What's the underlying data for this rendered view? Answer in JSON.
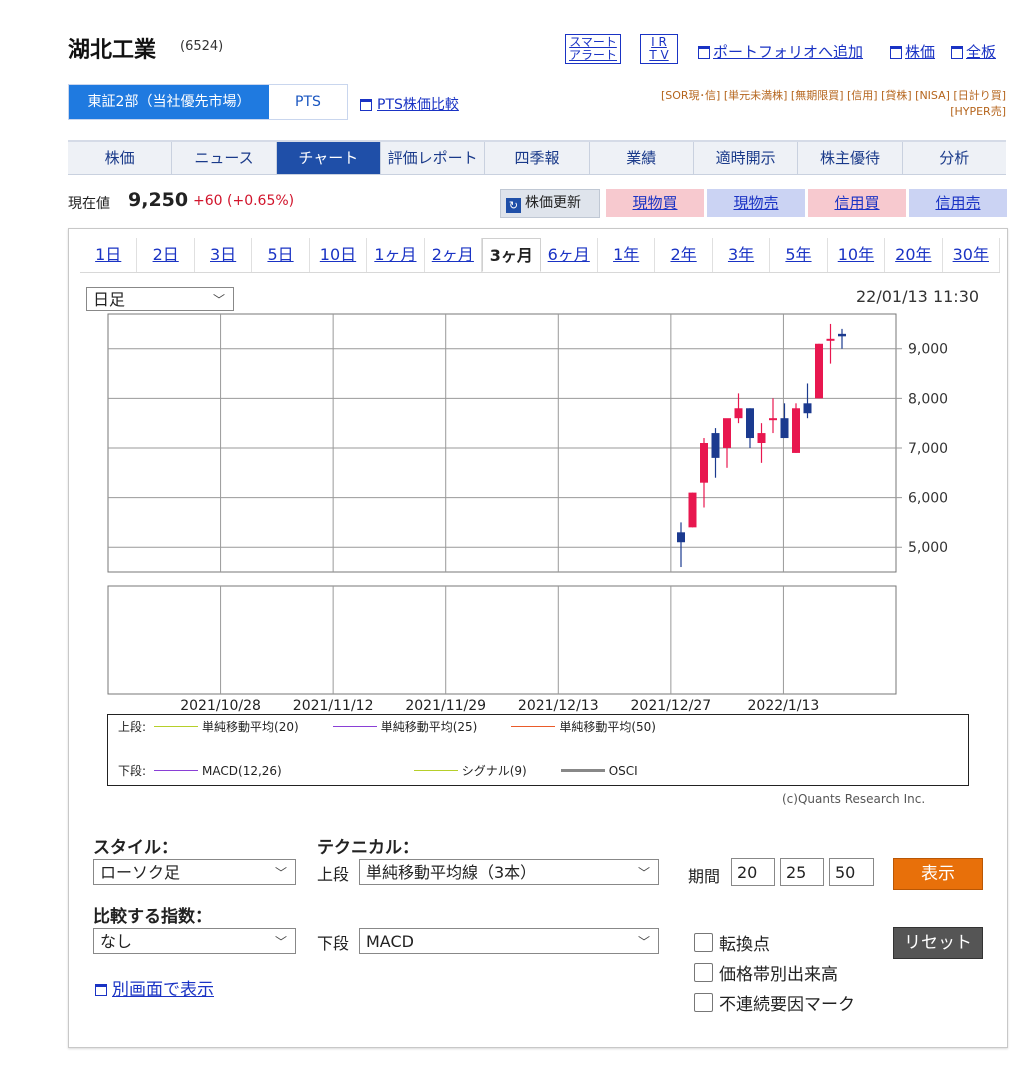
{
  "header": {
    "company": "湖北工業",
    "code": "(6524)",
    "smart_alert": [
      "スマート",
      "アラート"
    ],
    "ir_tv": [
      "I R",
      "T V"
    ],
    "portfolio_link": "ポートフォリオへ追加",
    "stock_price_link": "株価",
    "board_link": "全板"
  },
  "market": {
    "active": "東証2部（当社優先市場）",
    "pts": "PTS",
    "compare": "PTS株価比較"
  },
  "badges": {
    "line1": "[SOR現･信] [単元未満株] [無期限買] [信用] [貸株] [NISA] [日計り買]",
    "line2": "[HYPER売]"
  },
  "tabs": [
    {
      "label": "株価",
      "active": false
    },
    {
      "label": "ニュース",
      "active": false
    },
    {
      "label": "チャート",
      "active": true
    },
    {
      "label": "評価レポート",
      "active": false
    },
    {
      "label": "四季報",
      "active": false
    },
    {
      "label": "業績",
      "active": false
    },
    {
      "label": "適時開示",
      "active": false
    },
    {
      "label": "株主優待",
      "active": false
    },
    {
      "label": "分析",
      "active": false
    }
  ],
  "price": {
    "label": "現在値",
    "value": "9,250",
    "change": "+60 (+0.65%)",
    "refresh": "株価更新",
    "buy_cash": "現物買",
    "sell_cash": "現物売",
    "buy_margin": "信用買",
    "sell_margin": "信用売"
  },
  "periods": [
    "1日",
    "2日",
    "3日",
    "5日",
    "10日",
    "1ヶ月",
    "2ヶ月",
    "3ヶ月",
    "6ヶ月",
    "1年",
    "2年",
    "3年",
    "5年",
    "10年",
    "20年",
    "30年"
  ],
  "active_period": "3ヶ月",
  "chart_controls": {
    "interval": "日足",
    "timestamp": "22/01/13 11:30",
    "copyright": "(c)Quants Research Inc."
  },
  "chart_data": {
    "type": "candlestick",
    "ylim": [
      4500,
      9700
    ],
    "y_ticks": [
      5000,
      6000,
      7000,
      8000,
      9000
    ],
    "y_tick_labels": [
      "5,000",
      "6,000",
      "7,000",
      "8,000",
      "9,000"
    ],
    "x_tick_labels": [
      "2021/10/28",
      "2021/11/12",
      "2021/11/29",
      "2021/12/13",
      "2021/12/27",
      "2022/1/13"
    ],
    "candles": [
      {
        "o": 5300,
        "h": 5500,
        "l": 4600,
        "c": 5100
      },
      {
        "o": 5400,
        "h": 6100,
        "l": 5400,
        "c": 6100
      },
      {
        "o": 6300,
        "h": 7200,
        "l": 5800,
        "c": 7100
      },
      {
        "o": 7300,
        "h": 7400,
        "l": 6400,
        "c": 6800
      },
      {
        "o": 7000,
        "h": 7500,
        "l": 6600,
        "c": 7600
      },
      {
        "o": 7600,
        "h": 8100,
        "l": 7500,
        "c": 7800
      },
      {
        "o": 7800,
        "h": 7800,
        "l": 7000,
        "c": 7200
      },
      {
        "o": 7100,
        "h": 7500,
        "l": 6700,
        "c": 7300
      },
      {
        "o": 7600,
        "h": 8000,
        "l": 7300,
        "c": 7600
      },
      {
        "o": 7600,
        "h": 7900,
        "l": 7200,
        "c": 7200
      },
      {
        "o": 6900,
        "h": 7900,
        "l": 6900,
        "c": 7800
      },
      {
        "o": 7900,
        "h": 8300,
        "l": 7600,
        "c": 7700
      },
      {
        "o": 8000,
        "h": 9100,
        "l": 8000,
        "c": 9100
      },
      {
        "o": 9200,
        "h": 9500,
        "l": 8700,
        "c": 9200
      },
      {
        "o": 9300,
        "h": 9400,
        "l": 9000,
        "c": 9250
      }
    ],
    "colors": {
      "up": "#e8174f",
      "down": "#1b3a8f"
    }
  },
  "legend": {
    "upper_label": "上段:",
    "lower_label": "下段:",
    "upper": [
      {
        "name": "単純移動平均(20)",
        "color": "#b6cf2a"
      },
      {
        "name": "単純移動平均(25)",
        "color": "#8a3fd6"
      },
      {
        "name": "単純移動平均(50)",
        "color": "#ea5b2a"
      }
    ],
    "lower": [
      {
        "name": "MACD(12,26)",
        "color": "#8a3fd6"
      },
      {
        "name": "シグナル(9)",
        "color": "#b6cf2a"
      },
      {
        "name": "OSCI",
        "color": "#888888"
      }
    ]
  },
  "controls": {
    "style_label": "スタイル：",
    "style_value": "ローソク足",
    "technical_label": "テクニカル：",
    "upper_label": "上段",
    "upper_value": "単純移動平均線（3本）",
    "period_label": "期間",
    "period_values": [
      "20",
      "25",
      "50"
    ],
    "show_button": "表示",
    "compare_label": "比較する指数：",
    "compare_value": "なし",
    "lower_label": "下段",
    "lower_value": "MACD",
    "reset_button": "リセット",
    "checkboxes": [
      "転換点",
      "価格帯別出来高",
      "不連続要因マーク"
    ],
    "new_window": "別画面で表示"
  }
}
